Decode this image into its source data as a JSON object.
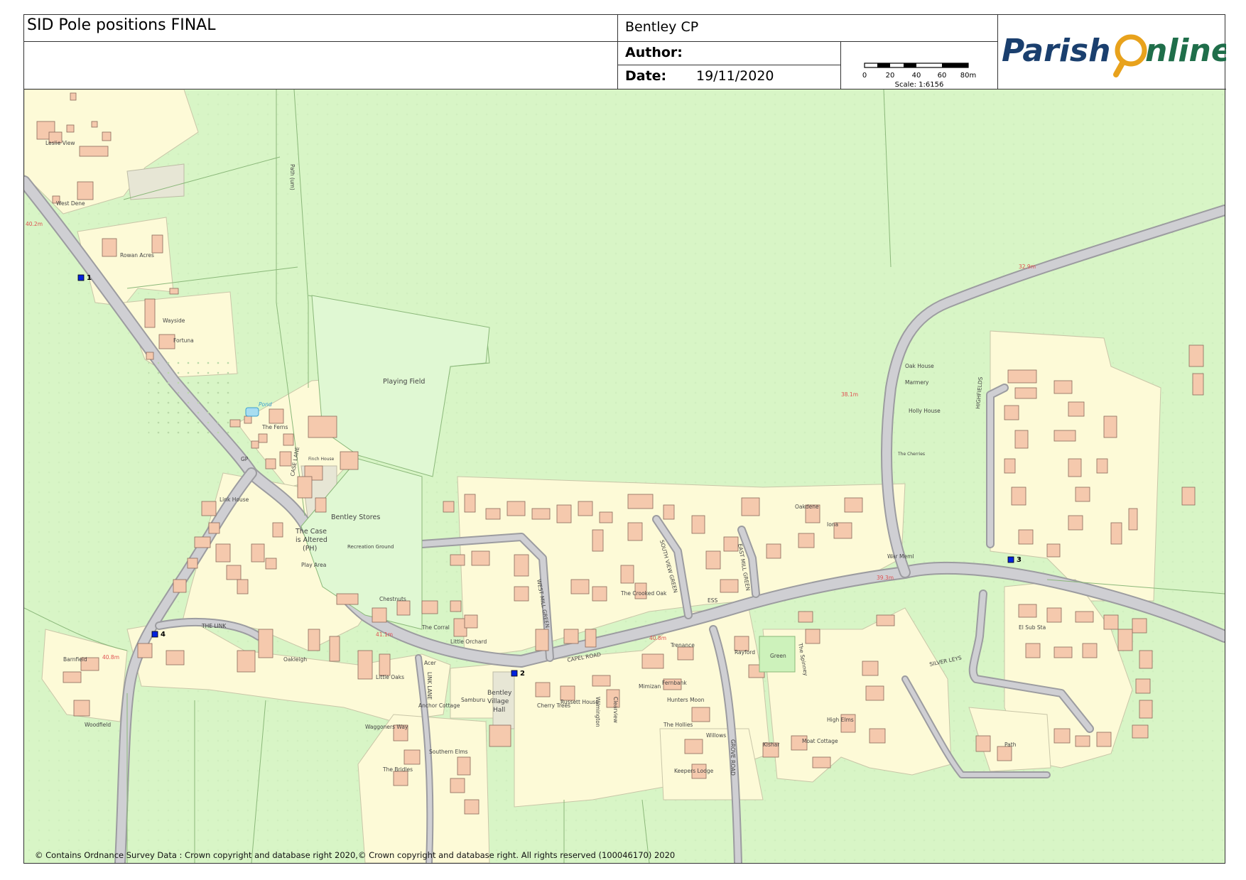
{
  "header": {
    "title": "SID Pole positions FINAL",
    "parish": "Bentley CP",
    "author_label": "Author:",
    "date_label": "Date:",
    "date_value": "19/11/2020",
    "scale_ticks": [
      "0",
      "20",
      "40",
      "60",
      "80m"
    ],
    "scale_text": "Scale: 1:6156",
    "logo_part1": "Parish",
    "logo_part2": "nline",
    "logo_colors": {
      "dark": "#1a3f6e",
      "green": "#1f6e4a",
      "orange": "#e8a21c"
    }
  },
  "map": {
    "colors": {
      "field": "#d8f5c6",
      "plot": "#fdfad7",
      "building": "#f5c9ad",
      "road": "#c8c8cc",
      "pole": "#0022dd"
    },
    "poles": [
      "1",
      "2",
      "3",
      "4"
    ],
    "labels": {
      "leslie_view": "Leslie View",
      "west_dene": "West Dene",
      "rowan_acres": "Rowan Acres",
      "wayside": "Wayside",
      "fortuna": "Fortuna",
      "pond": "Pond",
      "the_ferns": "The Ferns",
      "gp": "GP",
      "case_lane": "CASE LANE",
      "finch_house": "Finch House",
      "link_house": "Link House",
      "the_case_1": "The Case",
      "the_case_2": "is Altered",
      "the_case_3": "(PH)",
      "bentley_stores": "Bentley Stores",
      "recreation_ground": "Recreation Ground",
      "play_area": "Play Area",
      "playing_field": "Playing Field",
      "path_um": "Path (um)",
      "the_link": "THE LINK",
      "oakleigh": "Oakleigh",
      "barnfield": "Barnfield",
      "woodfield": "Woodfield",
      "the_corral": "The Corral",
      "little_orchard": "Little Orchard",
      "chestnuts": "Chestnuts",
      "capel_road": "CAPEL ROAD",
      "link_lane": "LINK LANE",
      "samburu": "Samburu",
      "hall_1": "Bentley",
      "hall_2": "Village",
      "hall_3": "Hall",
      "cherry_trees": "Cherry Trees",
      "russett_house": "Russett House",
      "wilmington": "Wilmington",
      "clearview": "Clearview",
      "mimizan": "Mimizan",
      "trenance": "Trenance",
      "fernbank": "Fernbank",
      "hunters_moon": "Hunters Moon",
      "the_hollies": "The Hollies",
      "willows": "Willows",
      "grove_road": "GROVE ROAD",
      "kishar": "Kishar",
      "moat_cottage": "Moat Cottage",
      "keepers_lodge": "Keepers Lodge",
      "west_mill_green": "WEST MILL GREEN",
      "south_view_green": "SOUTH VIEW GREEN",
      "east_mill_green": "EAST MILL GREEN",
      "ess": "ESS",
      "oakdene": "Oakdene",
      "iona": "Iona",
      "green": "Green",
      "the_spinney": "The Spinney",
      "silver_leys": "SILVER LEYS",
      "highfields": "HIGHFIELDS",
      "oak_house": "Oak House",
      "marmery": "Marmery",
      "holly_house": "Holly House",
      "the_cherries": "The Cherries",
      "war_meml": "War Meml",
      "el_sub_sta": "El Sub Sta",
      "path": "Path",
      "high_elms": "High Elms",
      "acer": "Acer",
      "anchor_cottage": "Anchor Cottage",
      "waggoners_way": "Waggoners Way",
      "southern_elms": "Southern Elms",
      "the_bridles": "The Bridles",
      "little_oaks": "Little Oaks",
      "the_crooked_oak": "The Crooked Oak",
      "rayford": "Rayford"
    },
    "spot_heights": [
      "40.2m",
      "32.9m",
      "38.1m",
      "39.3m",
      "41.1m",
      "40.8m",
      "40.8m"
    ]
  },
  "copyright": "© Contains Ordnance Survey Data : Crown copyright and database right 2020,© Crown copyright and database right. All rights reserved (100046170) 2020"
}
